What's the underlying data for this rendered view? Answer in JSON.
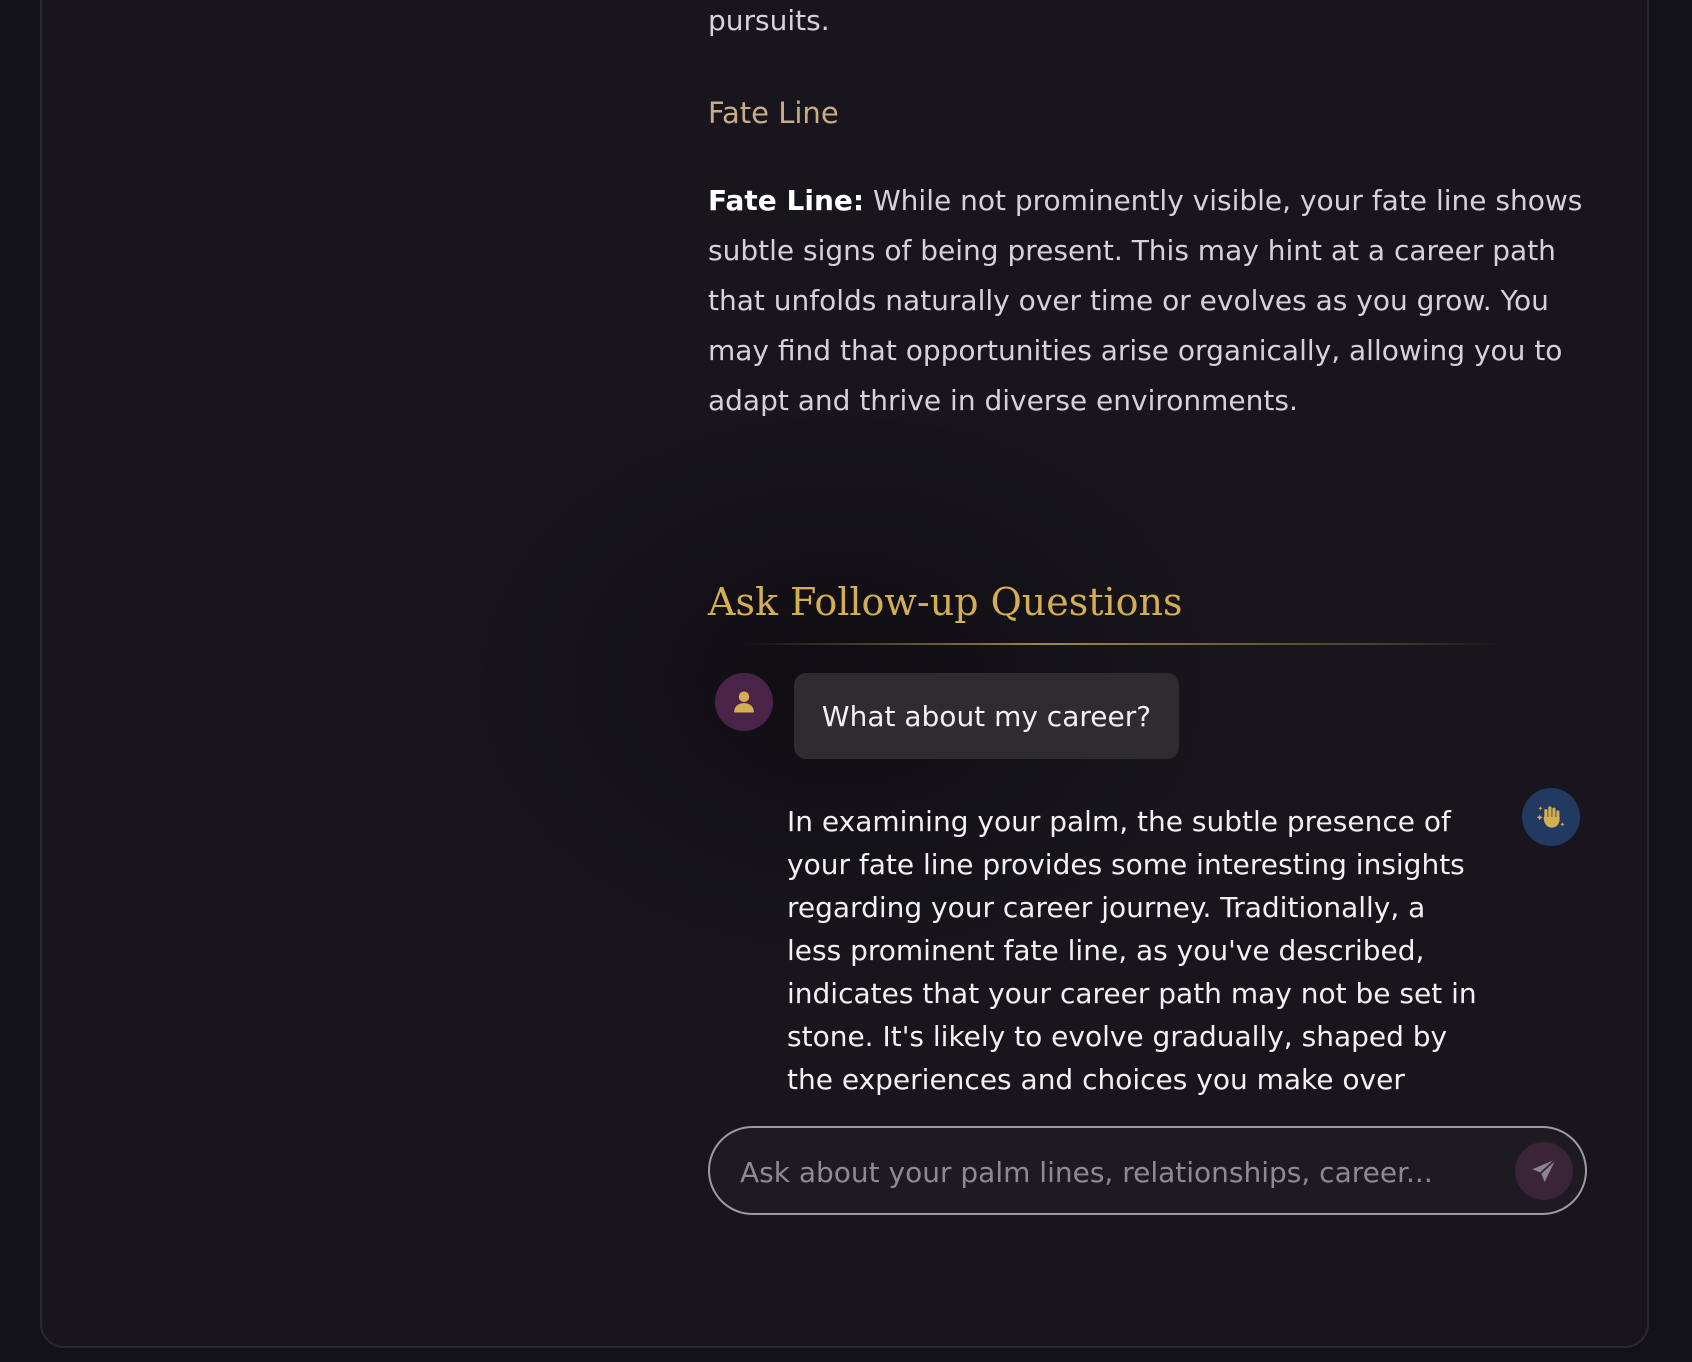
{
  "reading": {
    "intro_text": "clear sense of purpose and a strong focus on intellectual pursuits.",
    "section": {
      "heading": "Fate Line",
      "label": "Fate Line:",
      "text": "While not prominently visible, your fate line shows subtle signs of being present. This may hint at a career path that unfolds naturally over time or evolves as you grow. You may find that opportunities arise organically, allowing you to adapt and thrive in diverse environments."
    }
  },
  "followup": {
    "title": "Ask Follow-up Questions",
    "messages": [
      {
        "role": "user",
        "text": "What about my career?",
        "avatar_icon": "user-icon"
      },
      {
        "role": "assistant",
        "text": "In examining your palm, the subtle presence of your fate line provides some interesting insights regarding your career journey. Traditionally, a less prominent fate line, as you've described, indicates that your career path may not be set in stone. It's likely to evolve gradually, shaped by the experiences and choices you make over",
        "avatar_icon": "palm-sparkle-icon"
      }
    ],
    "input": {
      "placeholder": "Ask about your palm lines, relationships, career...",
      "value": ""
    },
    "send_icon": "send-icon"
  },
  "colors": {
    "background": "#141219",
    "card": "#18151d",
    "heading_gold": "#d4ae52",
    "section_heading": "#c9ad86",
    "user_avatar": "#4a2448",
    "bot_avatar": "#223a62",
    "user_bubble": "#2e2c30"
  }
}
